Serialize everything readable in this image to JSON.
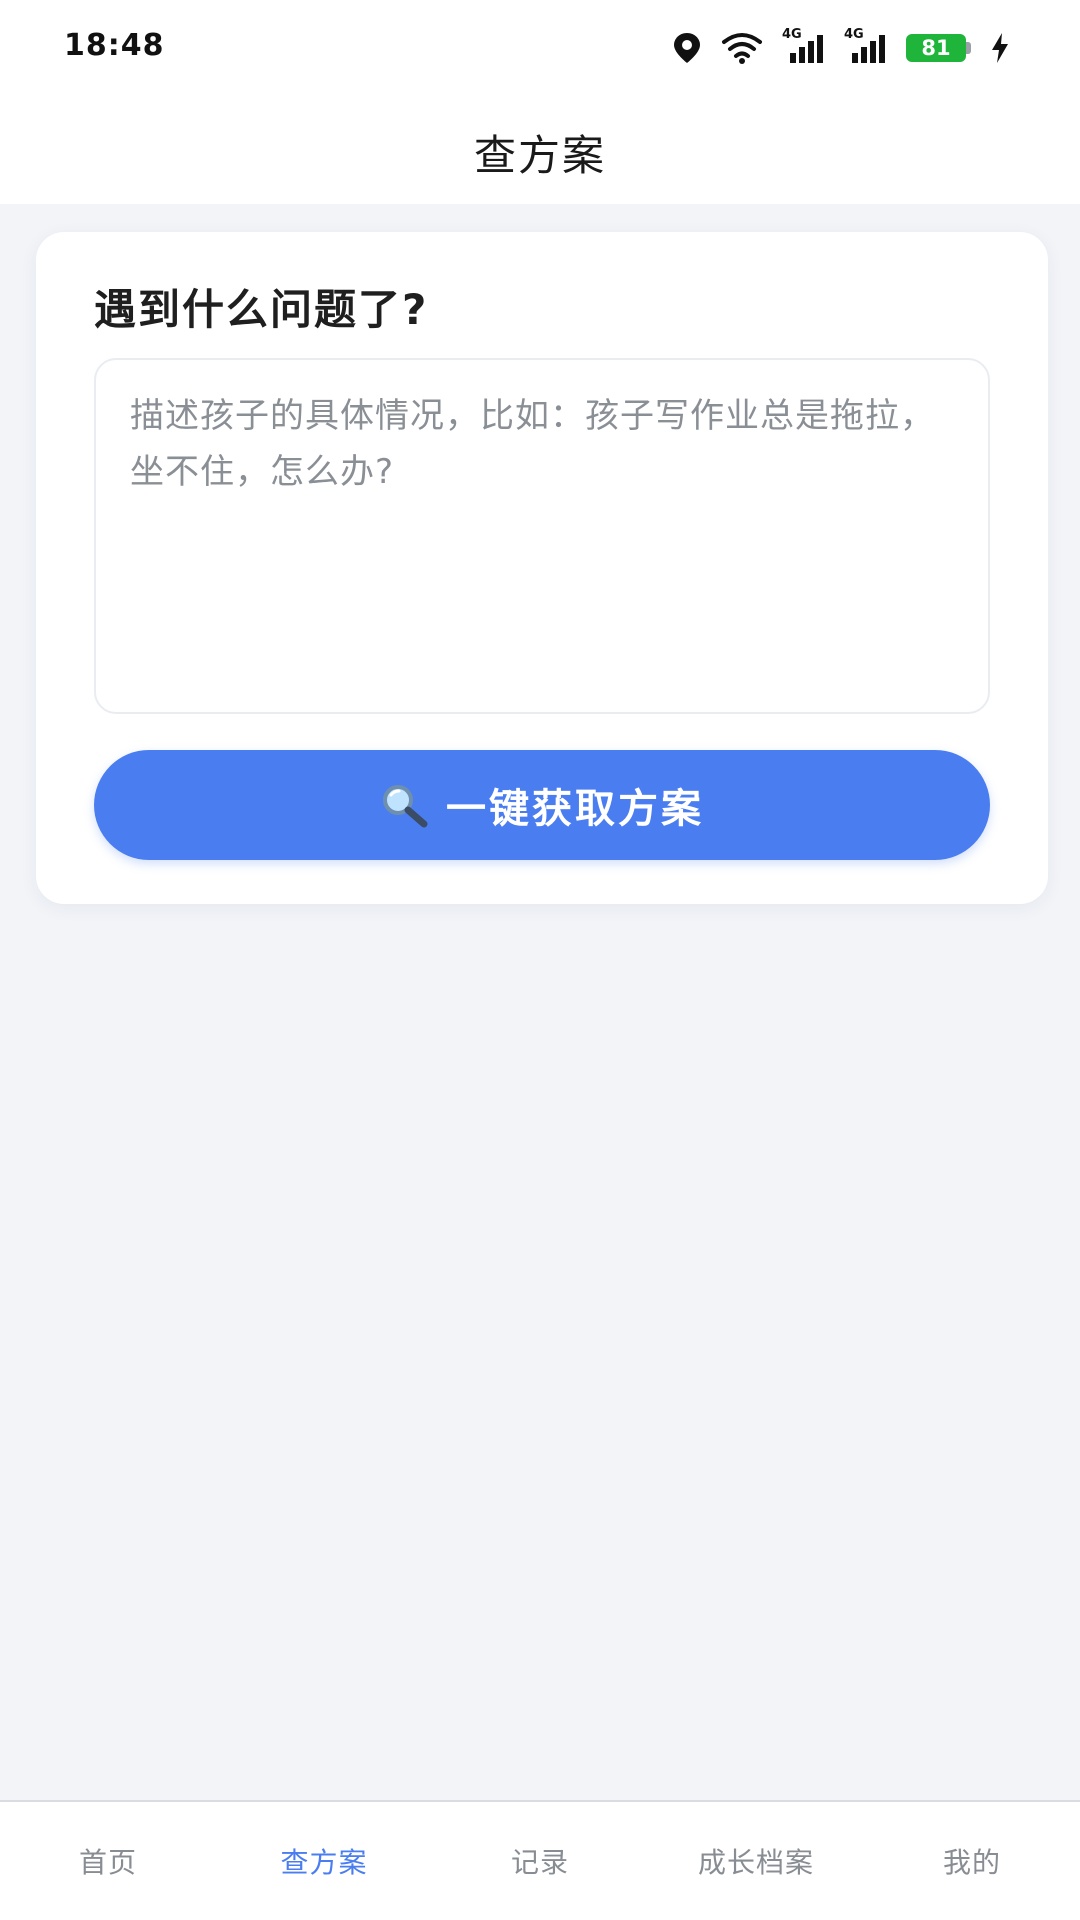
{
  "status_bar": {
    "time": "18:48",
    "battery_level": "81",
    "network_1": "4G",
    "network_2": "4G",
    "icons": [
      "location-icon",
      "wifi-icon",
      "signal-4g-icon",
      "signal-4g-icon",
      "battery-icon",
      "charging-icon"
    ]
  },
  "header": {
    "title": "查方案"
  },
  "card": {
    "question": "遇到什么问题了?",
    "input_placeholder": "描述孩子的具体情况，比如：孩子写作业总是拖拉，坐不住，怎么办?",
    "input_value": "",
    "button_label": "一键获取方案",
    "button_icon": "magnifier-icon"
  },
  "bottom_nav": {
    "active_index": 1,
    "items": [
      {
        "label": "首页"
      },
      {
        "label": "查方案"
      },
      {
        "label": "记录"
      },
      {
        "label": "成长档案"
      },
      {
        "label": "我的"
      }
    ]
  },
  "colors": {
    "accent": "#4a7ef0",
    "page_background": "#f2f4f8",
    "battery": "#1fb43a",
    "nav_inactive": "#888c93"
  }
}
